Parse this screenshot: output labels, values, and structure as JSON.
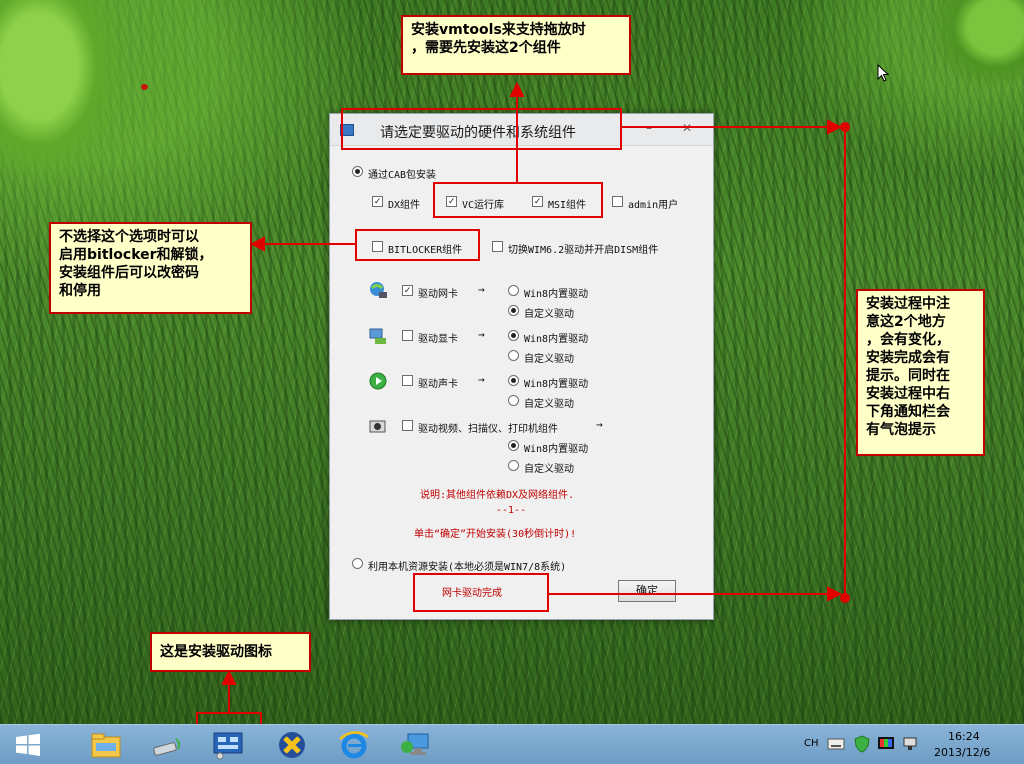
{
  "dialog": {
    "title": "请选定要驱动的硬件和系统组件",
    "minimize": "–",
    "close": "✕",
    "cab_install": "通过CAB包安装",
    "dx": "DX组件",
    "vc": "VC运行库",
    "msi": "MSI组件",
    "admin": "admin用户",
    "bitlocker": "BITLOCKER组件",
    "switch_dism": "切换WIM6.2驱动并开启DISM组件",
    "net_card": "驱动网卡",
    "gpu": "驱动显卡",
    "audio": "驱动声卡",
    "imaging": "驱动视频、扫描仪、打印机组件",
    "arrow": "→",
    "win8_builtin": "Win8内置驱动",
    "custom": "自定义驱动",
    "note": "说明:其他组件依赖DX及网络组件.",
    "page": "--1--",
    "start_hint": "单击“确定”开始安装(30秒倒计时)!",
    "local_install": "利用本机资源安装(本地必须是WIN7/8系统)",
    "status": "网卡驱动完成",
    "ok": "确定"
  },
  "annotations": {
    "top": "安装vmtools来支持拖放时\n，需要先安装这2个组件",
    "left": "不选择这个选项时可以\n启用bitlocker和解锁，\n安装组件后可以改密码\n和停用",
    "right": "安装过程中注\n意这2个地方\n，会有变化，\n安装完成会有\n提示。同时在\n安装过程中右\n下角通知栏会\n有气泡提示",
    "bottom": "这是安装驱动图标"
  },
  "taskbar": {
    "lang": "CH",
    "time": "16:24",
    "date": "2013/12/6"
  },
  "colors": {
    "annotation_border": "#c00000",
    "annotation_fill": "#ffffc8",
    "taskbar": "#7aa6cc"
  }
}
